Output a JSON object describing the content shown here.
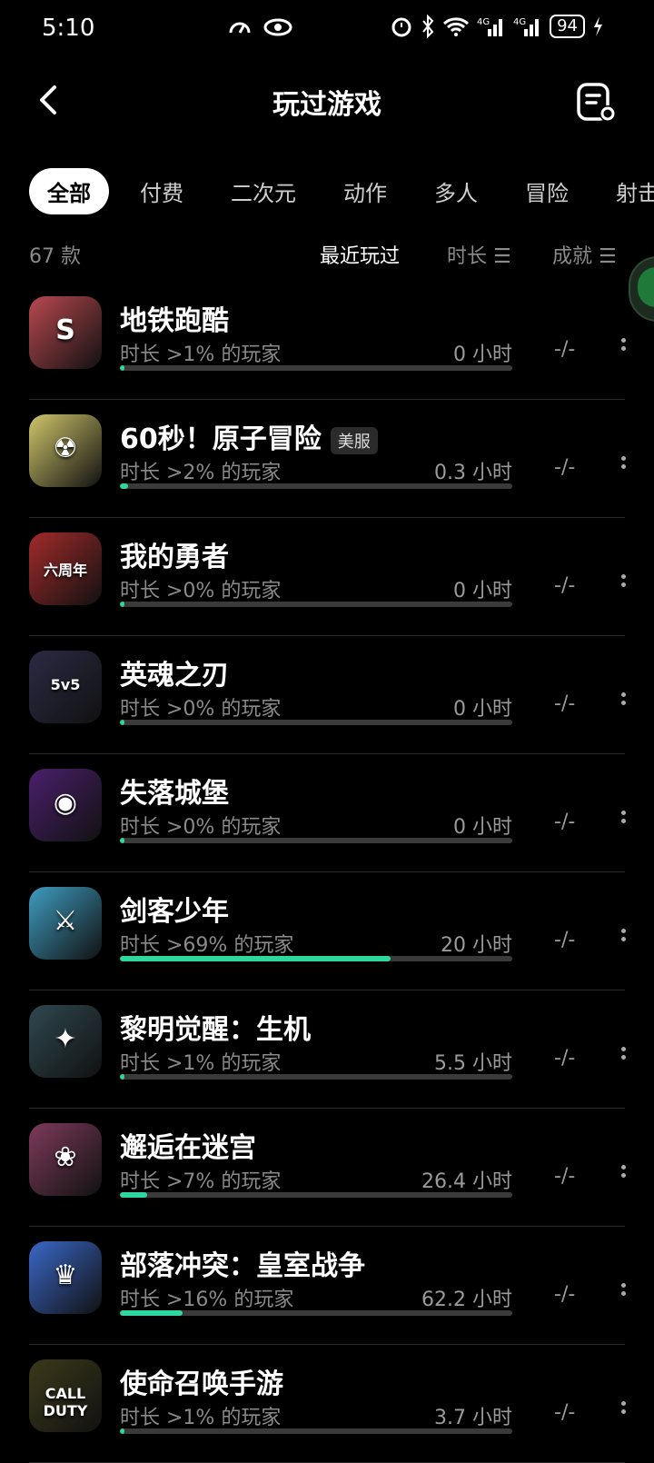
{
  "status_bar": {
    "time": "5:10",
    "battery": "94",
    "net1": "4G",
    "net2": "4G"
  },
  "header": {
    "title": "玩过游戏"
  },
  "tabs": [
    {
      "label": "全部",
      "active": true
    },
    {
      "label": "付费"
    },
    {
      "label": "二次元"
    },
    {
      "label": "动作"
    },
    {
      "label": "多人"
    },
    {
      "label": "冒险"
    },
    {
      "label": "射击"
    }
  ],
  "sort": {
    "count": "67 款",
    "recent": "最近玩过",
    "duration": "时长 ☰",
    "achievement": "成就 ☰"
  },
  "games": [
    {
      "name": "地铁跑酷",
      "sub": "时长 >1% 的玩家",
      "hours": "0 小时",
      "ach": "-/-",
      "progress": 0.01,
      "icon_color": "#b8484e",
      "icon_char": "S"
    },
    {
      "name": "60秒！原子冒险",
      "region": "美服",
      "sub": "时长 >2% 的玩家",
      "hours": "0.3 小时",
      "ach": "-/-",
      "progress": 0.02,
      "icon_color": "#cfc56a",
      "icon_char": "☢"
    },
    {
      "name": "我的勇者",
      "sub": "时长 >0% 的玩家",
      "hours": "0 小时",
      "ach": "-/-",
      "progress": 0.0,
      "icon_color": "#a22a2a",
      "icon_char": "六周年"
    },
    {
      "name": "英魂之刃",
      "sub": "时长 >0% 的玩家",
      "hours": "0 小时",
      "ach": "-/-",
      "progress": 0.0,
      "icon_color": "#2b2a44",
      "icon_char": "5v5"
    },
    {
      "name": "失落城堡",
      "sub": "时长 >0% 的玩家",
      "hours": "0 小时",
      "ach": "-/-",
      "progress": 0.0,
      "icon_color": "#4a1f6b",
      "icon_char": "◉"
    },
    {
      "name": "剑客少年",
      "sub": "时长 >69% 的玩家",
      "hours": "20 小时",
      "ach": "-/-",
      "progress": 0.69,
      "icon_color": "#3e9cc0",
      "icon_char": "⚔"
    },
    {
      "name": "黎明觉醒：生机",
      "sub": "时长 >1% 的玩家",
      "hours": "5.5 小时",
      "ach": "-/-",
      "progress": 0.01,
      "icon_color": "#2f4850",
      "icon_char": "✦"
    },
    {
      "name": "邂逅在迷宫",
      "sub": "时长 >7% 的玩家",
      "hours": "26.4 小时",
      "ach": "-/-",
      "progress": 0.07,
      "icon_color": "#7d3a5a",
      "icon_char": "❀"
    },
    {
      "name": "部落冲突：皇室战争",
      "sub": "时长 >16% 的玩家",
      "hours": "62.2 小时",
      "ach": "-/-",
      "progress": 0.16,
      "icon_color": "#3a67c8",
      "icon_char": "♛"
    },
    {
      "name": "使命召唤手游",
      "sub": "时长 >1% 的玩家",
      "hours": "3.7 小时",
      "ach": "-/-",
      "progress": 0.01,
      "icon_color": "#3b3a1a",
      "icon_char": "CALL\nDUTY"
    }
  ]
}
